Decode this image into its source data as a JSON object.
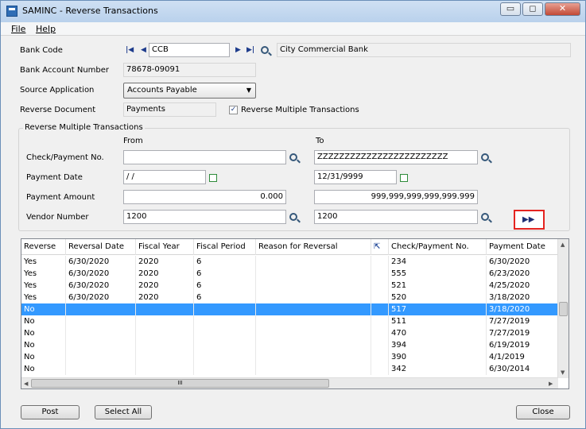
{
  "window": {
    "title": "SAMINC - Reverse Transactions",
    "minimize": "▭",
    "maximize": "◻",
    "close": "✕"
  },
  "menu": {
    "file": "File",
    "help": "Help"
  },
  "header": {
    "bank_code_label": "Bank Code",
    "bank_code_value": "CCB",
    "bank_name": "City Commercial Bank",
    "bank_account_label": "Bank Account Number",
    "bank_account_value": "78678-09091",
    "source_app_label": "Source Application",
    "source_app_value": "Accounts Payable",
    "reverse_doc_label": "Reverse Document",
    "reverse_doc_value": "Payments",
    "reverse_multiple_label": "Reverse Multiple Transactions",
    "reverse_multiple_checked": true
  },
  "range": {
    "group_title": "Reverse Multiple Transactions",
    "from_label": "From",
    "to_label": "To",
    "check_label": "Check/Payment No.",
    "check_from": "",
    "check_to": "ZZZZZZZZZZZZZZZZZZZZZZZZ",
    "date_label": "Payment Date",
    "date_from": " / /",
    "date_to": "12/31/9999",
    "amount_label": "Payment Amount",
    "amount_from": "0.000",
    "amount_to": "999,999,999,999,999.999",
    "vendor_label": "Vendor Number",
    "vendor_from": "1200",
    "vendor_to": "1200",
    "go_glyph": "▶▶"
  },
  "grid": {
    "columns": [
      "Reverse",
      "Reversal Date",
      "Fiscal Year",
      "Fiscal Period",
      "Reason for Reversal",
      "",
      "Check/Payment No.",
      "Payment Date"
    ],
    "rows": [
      [
        "Yes",
        "6/30/2020",
        "2020",
        "6",
        "",
        "",
        "234",
        "6/30/2020"
      ],
      [
        "Yes",
        "6/30/2020",
        "2020",
        "6",
        "",
        "",
        "555",
        "6/23/2020"
      ],
      [
        "Yes",
        "6/30/2020",
        "2020",
        "6",
        "",
        "",
        "521",
        "4/25/2020"
      ],
      [
        "Yes",
        "6/30/2020",
        "2020",
        "6",
        "",
        "",
        "520",
        "3/18/2020"
      ],
      [
        "No",
        "",
        "",
        "",
        "",
        "",
        "517",
        "3/18/2020"
      ],
      [
        "No",
        "",
        "",
        "",
        "",
        "",
        "511",
        "7/27/2019"
      ],
      [
        "No",
        "",
        "",
        "",
        "",
        "",
        "470",
        "7/27/2019"
      ],
      [
        "No",
        "",
        "",
        "",
        "",
        "",
        "394",
        "6/19/2019"
      ],
      [
        "No",
        "",
        "",
        "",
        "",
        "",
        "390",
        "4/1/2019"
      ],
      [
        "No",
        "",
        "",
        "",
        "",
        "",
        "342",
        "6/30/2014"
      ]
    ],
    "selected_row": 4,
    "scroll_grip": "III"
  },
  "buttons": {
    "post": "Post",
    "select_all": "Select All",
    "close": "Close"
  }
}
